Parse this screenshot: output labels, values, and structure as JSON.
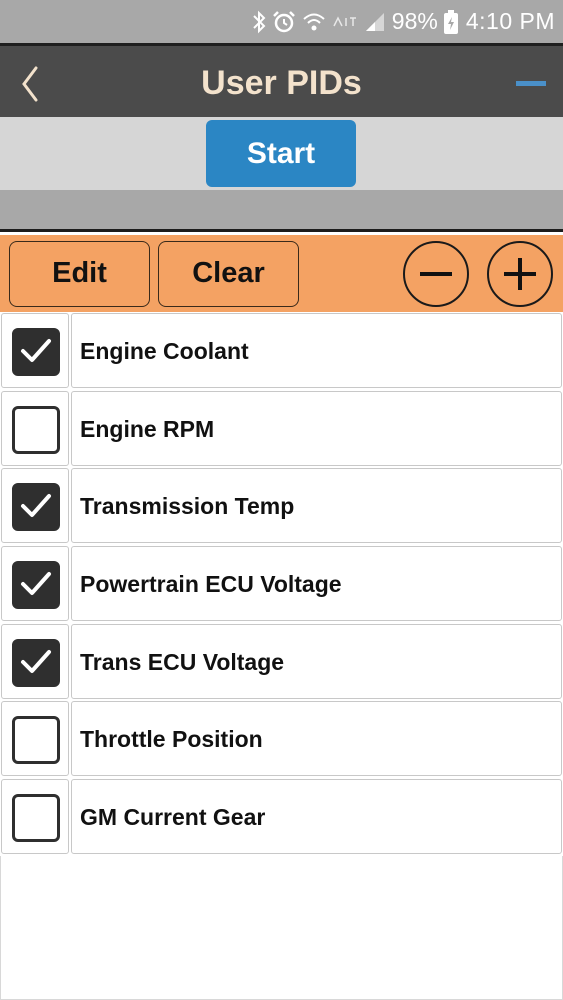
{
  "status_bar": {
    "battery": "98%",
    "time": "4:10 PM",
    "icons": [
      "bluetooth-icon",
      "alarm-icon",
      "wifi-icon",
      "signal-icon",
      "battery-charging-icon"
    ]
  },
  "header": {
    "title": "User PIDs",
    "back_icon": "chevron-left-icon",
    "menu_icon": "collapse-icon"
  },
  "start_button": {
    "label": "Start"
  },
  "toolbar": {
    "edit_label": "Edit",
    "clear_label": "Clear",
    "minus_icon": "minus-circle-icon",
    "plus_icon": "plus-circle-icon"
  },
  "pids": [
    {
      "name": "Engine Coolant",
      "checked": true
    },
    {
      "name": "Engine RPM",
      "checked": false
    },
    {
      "name": "Transmission Temp",
      "checked": true
    },
    {
      "name": "Powertrain ECU Voltage",
      "checked": true
    },
    {
      "name": "Trans ECU Voltage",
      "checked": true
    },
    {
      "name": "Throttle Position",
      "checked": false
    },
    {
      "name": "GM Current Gear",
      "checked": false
    }
  ],
  "colors": {
    "status_bar": "#a8a8a8",
    "title_bar": "#4b4b4b",
    "title_text": "#f3e2cc",
    "accent_blue": "#2b86c4",
    "toolbar": "#f4a263",
    "checkbox": "#2f2f2f"
  }
}
